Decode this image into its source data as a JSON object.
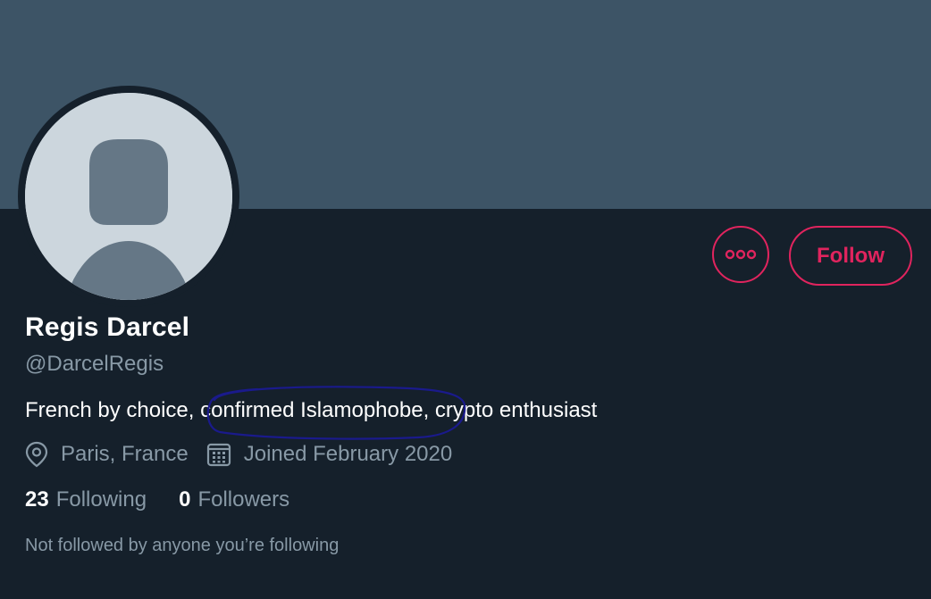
{
  "profile": {
    "name": "Regis Darcel",
    "handle": "@DarcelRegis",
    "bio_before": "French by choice, ",
    "bio_highlight": "confirmed Islamophobe,",
    "bio_after": " crypto enthusiast",
    "location": "Paris, France",
    "joined": "Joined February 2020"
  },
  "stats": {
    "following_count": "23",
    "following_label": "Following",
    "followers_count": "0",
    "followers_label": "Followers"
  },
  "actions": {
    "follow_label": "Follow",
    "more_icon": "more-horizontal-icon"
  },
  "footer_note": "Not followed by anyone you’re following",
  "colors": {
    "background": "#15202b",
    "banner": "#3d5466",
    "accent": "#e0245e",
    "secondary_text": "#8899a6",
    "annotation": "#1a1a8c"
  }
}
